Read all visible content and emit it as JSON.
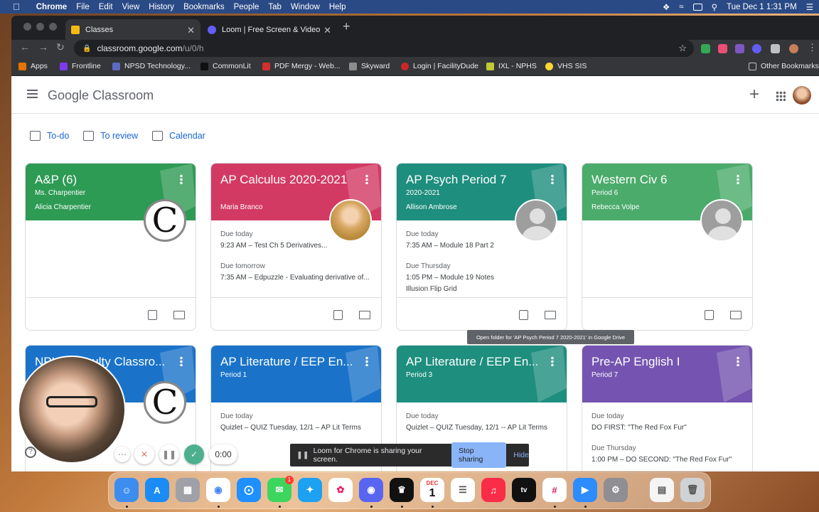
{
  "menubar": {
    "app": "Chrome",
    "items": [
      "File",
      "Edit",
      "View",
      "History",
      "Bookmarks",
      "People",
      "Tab",
      "Window",
      "Help"
    ],
    "datetime": "Tue Dec 1  1:31 PM"
  },
  "tabs": [
    {
      "title": "Classes",
      "active": true
    },
    {
      "title": "Loom | Free Screen & Video Re",
      "active": false
    }
  ],
  "address": {
    "domain": "classroom.google.com",
    "path": "/u/0/h"
  },
  "bookmarks": [
    "Apps",
    "Frontline",
    "NPSD Technology...",
    "CommonLit",
    "PDF Mergy - Web...",
    "Skyward",
    "Login | FacilityDude",
    "IXL - NPHS",
    "VHS SIS",
    "Other Bookmarks"
  ],
  "app": {
    "brand_google": "Google",
    "brand_product": "Classroom"
  },
  "subnav": [
    "To-do",
    "To review",
    "Calendar"
  ],
  "cards": [
    {
      "title": "A&P (6)",
      "subtitle": "Ms. Charpentier",
      "teacher": "Alicia Charpentier",
      "color": "#2e9b54",
      "avatar": "C",
      "items": []
    },
    {
      "title": "AP Calculus 2020-2021",
      "subtitle": "",
      "teacher": "Maria Branco",
      "color": "#d33a63",
      "avatar": "photo",
      "items": [
        {
          "label": "Due today",
          "text": "9:23 AM – Test Ch 5 Derivatives..."
        },
        {
          "label": "Due tomorrow",
          "text": "7:35 AM – Edpuzzle - Evaluating derivative of..."
        }
      ]
    },
    {
      "title": "AP Psych Period 7",
      "subtitle": "2020-2021",
      "teacher": "Allison Ambrose",
      "color": "#1e8e7e",
      "avatar": "gray",
      "items": [
        {
          "label": "Due today",
          "text": "7:35 AM – Module 18 Part 2"
        },
        {
          "label": "Due Thursday",
          "text": "1:05 PM – Module 19 Notes",
          "extra": "Illusion Flip Grid"
        }
      ]
    },
    {
      "title": "Western Civ 6",
      "subtitle": "Period 6",
      "teacher": "Rebecca Volpe",
      "color": "#4bab6b",
      "avatar": "gray",
      "items": []
    },
    {
      "title": "NPHS Faculty Classro...",
      "subtitle": "",
      "teacher": "",
      "color": "#1a73c9",
      "avatar": "C",
      "items": []
    },
    {
      "title": "AP Literature / EEP En...",
      "subtitle": "Period 1",
      "teacher": "",
      "color": "#1a73c9",
      "avatar": "",
      "items": [
        {
          "label": "Due today",
          "text": "Quizlet – QUIZ Tuesday, 12/1 – AP Lit Terms"
        }
      ]
    },
    {
      "title": "AP Literature / EEP En...",
      "subtitle": "Period 3",
      "teacher": "",
      "color": "#1e8e7e",
      "avatar": "",
      "items": [
        {
          "label": "Due today",
          "text": "Quizlet – QUIZ Tuesday, 12/1 -- AP Lit Terms"
        }
      ]
    },
    {
      "title": "Pre-AP English I",
      "subtitle": "Period 7",
      "teacher": "",
      "color": "#7454b0",
      "avatar": "",
      "items": [
        {
          "label": "Due today",
          "text": "DO FIRST: \"The Red Fox Fur\""
        },
        {
          "label": "Due Thursday",
          "text": "1:00 PM – DO SECOND: \"The Red Fox Fur\""
        }
      ]
    }
  ],
  "tooltip": "Open folder for 'AP Psych Period 7 2020-2021' in Google Drive",
  "loom": {
    "timer": "0:00",
    "message": "Loom for Chrome is sharing your screen.",
    "stop": "Stop sharing",
    "hide": "Hide"
  },
  "dock": {
    "calendar_month": "DEC",
    "calendar_day": "1",
    "messages_badge": "1"
  }
}
